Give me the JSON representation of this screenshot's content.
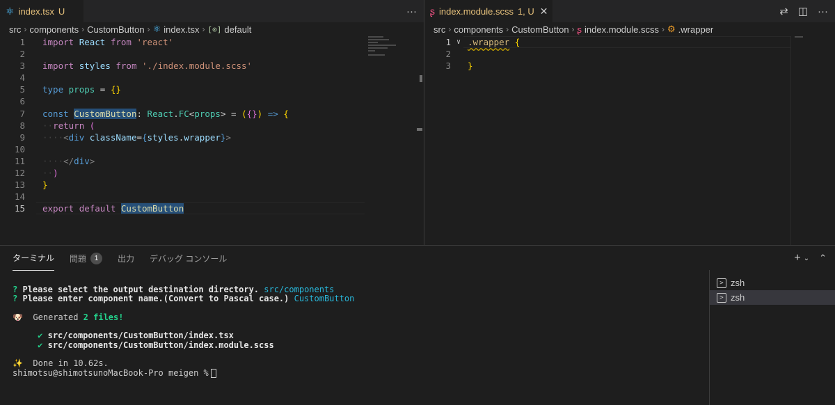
{
  "left_editor": {
    "tab": {
      "title": "index.tsx",
      "status": "U",
      "icon": "react-icon"
    },
    "more_actions": "···",
    "breadcrumb": [
      "src",
      "components",
      "CustomButton",
      "index.tsx",
      "default"
    ],
    "line_numbers": [
      "1",
      "2",
      "3",
      "4",
      "5",
      "6",
      "7",
      "8",
      "9",
      "10",
      "11",
      "12",
      "13",
      "14",
      "15"
    ],
    "current_line": "15"
  },
  "right_editor": {
    "tab": {
      "title": "index.module.scss",
      "status": "1, U",
      "icon": "sass-icon"
    },
    "breadcrumb": [
      "src",
      "components",
      "CustomButton",
      "index.module.scss",
      ".wrapper"
    ],
    "line_numbers": [
      "1",
      "2",
      "3"
    ]
  },
  "panel": {
    "tabs": [
      {
        "label": "ターミナル",
        "active": true
      },
      {
        "label": "問題",
        "badge": "1"
      },
      {
        "label": "出力"
      },
      {
        "label": "デバッグ コンソール"
      }
    ],
    "terminal_lines": {
      "l1_prefix": "?",
      "l1_text": "Please select the output destination directory.",
      "l1_answer": "src/components",
      "l2_prefix": "?",
      "l2_text": "Please enter component name.(Convert to Pascal case.)",
      "l2_answer": "CustomButton",
      "l3_emoji": "🐶",
      "l3_text_a": "Generated",
      "l3_count": "2 files!",
      "l4_check": "✔",
      "l4_text": "src/components/CustomButton/index.tsx",
      "l5_check": "✔",
      "l5_text": "src/components/CustomButton/index.module.scss",
      "l6_emoji": "✨",
      "l6_text": "Done in 10.62s.",
      "prompt": "shimotsu@shimotsunoMacBook-Pro meigen %"
    },
    "terminal_list": [
      "zsh",
      "zsh"
    ]
  },
  "colors": {
    "background": "#1e1e1e",
    "tab_modified": "#e5c07b",
    "keyword": "#c586c0",
    "string": "#ce9178",
    "type": "#4ec9b0",
    "terminal_green": "#23d18b",
    "terminal_cyan": "#29b8db"
  }
}
